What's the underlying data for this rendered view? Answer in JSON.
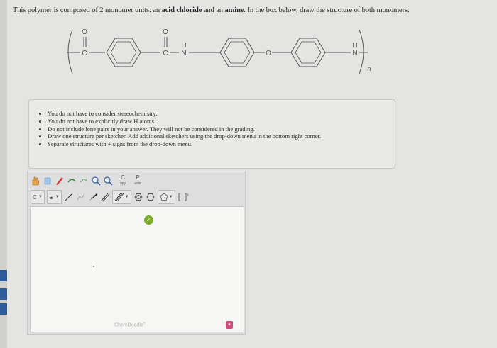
{
  "question": {
    "prefix": "This polymer is composed of 2 monomer units: an ",
    "term1": "acid chloride",
    "middle": " and an ",
    "term2": "amine",
    "suffix": ". In the box below, draw the structure of both monomers."
  },
  "structure": {
    "oxygen": "O",
    "carbon": "C",
    "hydrogen": "H",
    "nitrogen": "N",
    "subscript": "n"
  },
  "instructions": [
    "You do not have to consider stereochemistry.",
    "You do not have to explicitly draw H atoms.",
    "Do not include lone pairs in your answer. They will not be considered in the grading.",
    "Draw one structure per sketcher. Add additional sketchers using the drop-down menu in the bottom right corner.",
    "Separate structures with + signs from the drop-down menu."
  ],
  "sketcher": {
    "copy_label": "C",
    "copy_sub": "opy",
    "paste_label": "P",
    "paste_sub": "aste",
    "element_label": "C",
    "charge_label": "⊕",
    "brand": "ChemDoodle",
    "brand_mark": "®"
  },
  "icons": {
    "hand": "hand-icon",
    "eraser": "eraser-icon",
    "lasso": "lasso-icon",
    "zoom_in": "zoom-in-icon",
    "zoom_out": "zoom-out-icon"
  },
  "colors": {
    "accent_green": "#7fae2f",
    "menu_pink": "#d1497b",
    "side_blue": "#2f5d9b"
  }
}
